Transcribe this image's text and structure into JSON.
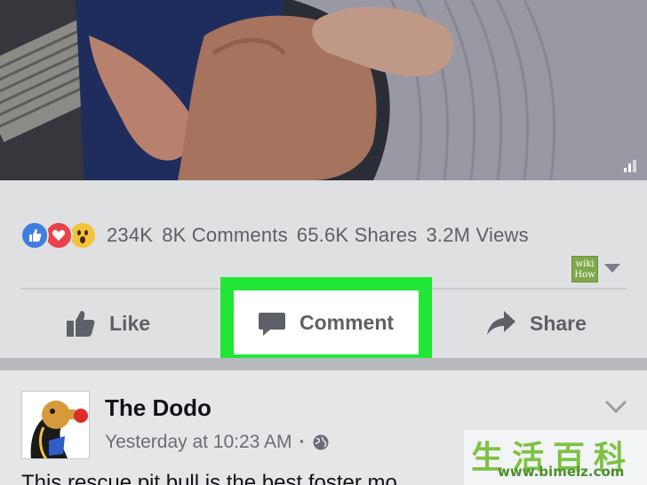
{
  "video": {
    "quality_icon": "signal-bars-icon"
  },
  "post": {
    "reactions": [
      "like-reaction-icon",
      "love-reaction-icon",
      "wow-reaction-icon"
    ],
    "stats": {
      "reactions": "234K",
      "comments": "8K Comments",
      "shares": "65.6K Shares",
      "views": "3.2M Views"
    },
    "actions": {
      "like": "Like",
      "comment": "Comment",
      "share": "Share"
    }
  },
  "highlight": {
    "color": "#22e636"
  },
  "wiki_badge": {
    "line1": "wiki",
    "line2": "How"
  },
  "next_post": {
    "page_name": "The Dodo",
    "time": "Yesterday at 10:23 AM",
    "separator": "·",
    "text": "This rescue pit bull is the best foster mo"
  },
  "watermark": {
    "chars": "生活百科",
    "url": "www.bimeiz.com"
  }
}
